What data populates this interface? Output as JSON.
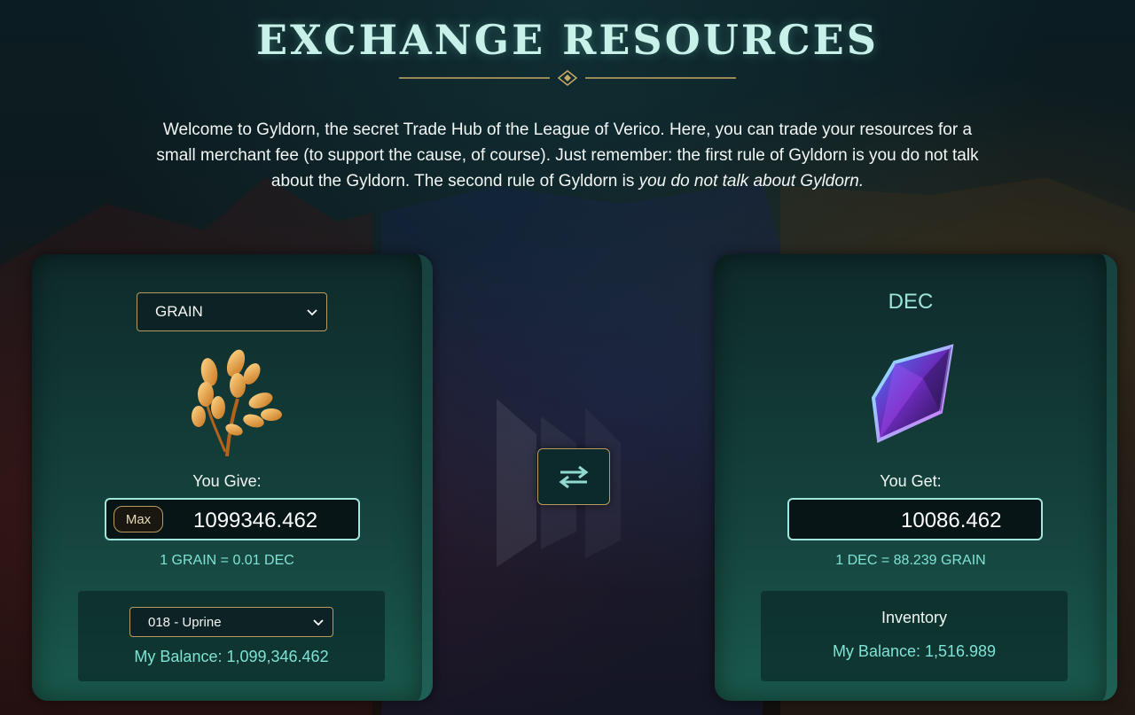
{
  "header": {
    "title": "EXCHANGE RESOURCES",
    "intro_main": "Welcome to Gyldorn, the secret Trade Hub of the League of Verico. Here, you can trade your resources for a small merchant fee (to support the cause, of course). Just remember: the first rule of Gyldorn is you do not talk about the Gyldorn. The second rule of Gyldorn is ",
    "intro_italic": "you do not talk about Gyldorn."
  },
  "give_panel": {
    "resource_selected": "GRAIN",
    "you_give_label": "You Give:",
    "max_label": "Max",
    "amount": "1099346.462",
    "rate": "1 GRAIN = 0.01 DEC",
    "location_selected": "018 - Uprine",
    "balance": "My Balance: 1,099,346.462",
    "icon": "grain-wheat-icon"
  },
  "swap": {
    "icon": "swap-arrows-icon"
  },
  "get_panel": {
    "resource": "DEC",
    "you_get_label": "You Get:",
    "amount": "10086.462",
    "rate": "1 DEC = 88.239 GRAIN",
    "inventory_label": "Inventory",
    "balance": "My Balance: 1,516.989",
    "icon": "dec-crystal-icon"
  },
  "colors": {
    "accent_teal": "#7fe3d6",
    "gold_border": "#b89c5e",
    "title_color": "#c8f1e9"
  }
}
